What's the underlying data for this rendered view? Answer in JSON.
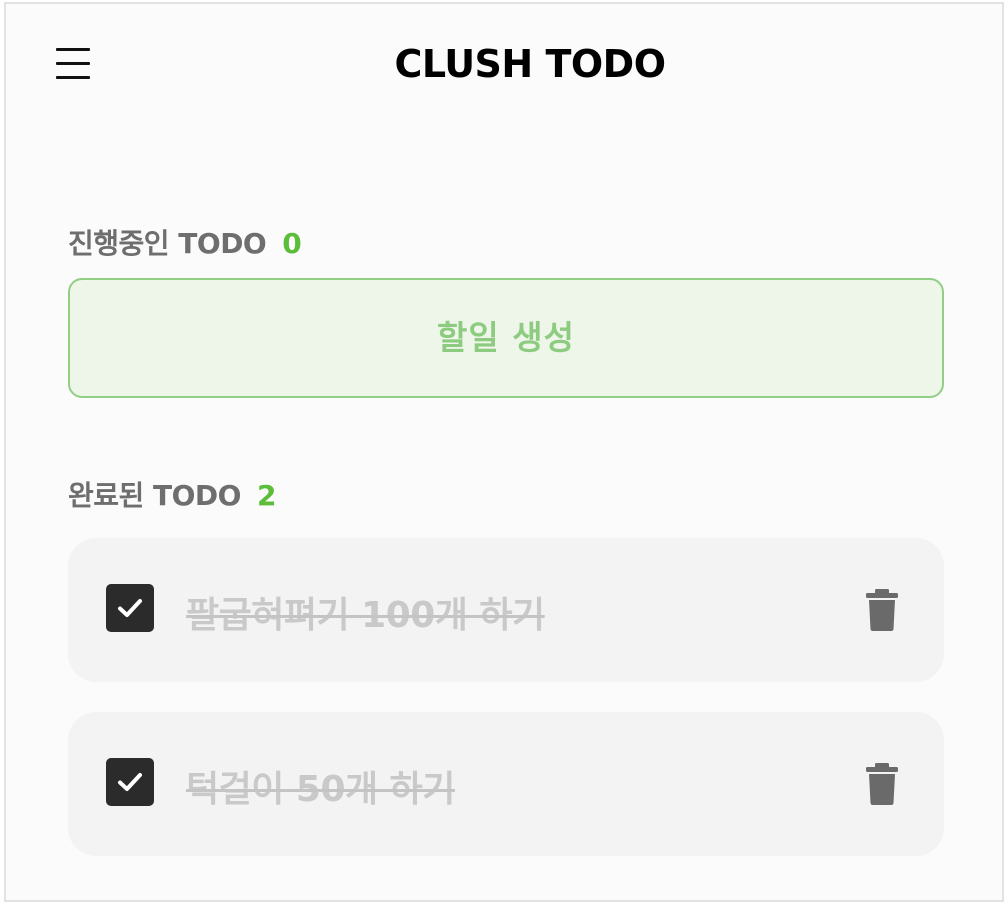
{
  "header": {
    "title": "CLUSH TODO",
    "menu_icon": "hamburger-menu-icon"
  },
  "in_progress": {
    "heading": "진행중인 TODO",
    "count": "0",
    "create_button_label": "할일 생성"
  },
  "completed": {
    "heading": "완료된 TODO",
    "count": "2",
    "items": [
      {
        "text": "팔굽혀펴기 100개 하기",
        "checked": true
      },
      {
        "text": "턱걸이 50개 하기",
        "checked": true
      }
    ]
  },
  "colors": {
    "accent_green": "#5bbd3a",
    "create_border": "#92cf85",
    "create_bg": "#eef5e9",
    "checkbox_bg": "#2b2b2b",
    "trash_icon": "#6a6a6a"
  },
  "icons": {
    "checkbox": "check-icon",
    "delete": "trash-icon"
  }
}
